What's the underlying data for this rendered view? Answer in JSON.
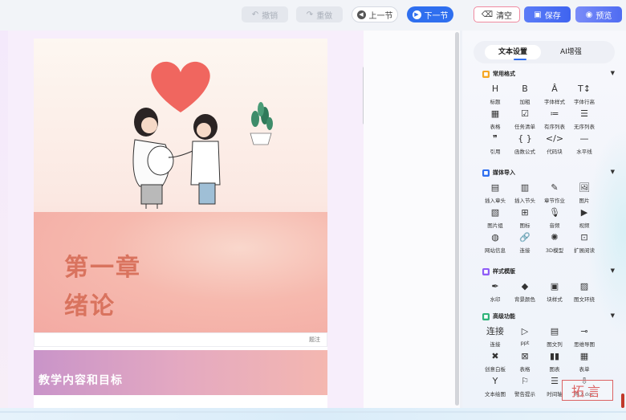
{
  "toolbar": {
    "undo": "撤销",
    "redo": "重做",
    "prev": "上一节",
    "next": "下一节",
    "clear": "清空",
    "save": "保存",
    "preview": "预览"
  },
  "editor": {
    "chapter_line1": "第一章",
    "chapter_line2": "绪论",
    "caption_label": "题注",
    "section_title": "教学内容和目标"
  },
  "panel": {
    "tabs": [
      "文本设置",
      "AI增强"
    ],
    "sections": [
      {
        "title": "常用格式",
        "color": "#f5a623",
        "tools": [
          {
            "glyph": "H",
            "label": "标题"
          },
          {
            "glyph": "B",
            "label": "加粗"
          },
          {
            "glyph": "Â",
            "label": "字体样式"
          },
          {
            "glyph": "T↕",
            "label": "字体行高"
          },
          {
            "glyph": "▦",
            "label": "表格"
          },
          {
            "glyph": "☑",
            "label": "任务清单"
          },
          {
            "glyph": "≔",
            "label": "有序列表"
          },
          {
            "glyph": "☰",
            "label": "无序列表"
          },
          {
            "glyph": "❞",
            "label": "引用"
          },
          {
            "glyph": "{ }",
            "label": "函数公式"
          },
          {
            "glyph": "</>",
            "label": "代码块"
          },
          {
            "glyph": "—",
            "label": "水平线"
          }
        ]
      },
      {
        "title": "媒体导入",
        "color": "#2f6fef",
        "tools": [
          {
            "glyph": "▤",
            "label": "插入章头"
          },
          {
            "glyph": "▥",
            "label": "插入节头"
          },
          {
            "glyph": "✎",
            "label": "章节作业"
          },
          {
            "glyph": "🖼",
            "label": "图片"
          },
          {
            "glyph": "▧",
            "label": "图片组"
          },
          {
            "glyph": "⊞",
            "label": "图标"
          },
          {
            "glyph": "🎙",
            "label": "音频"
          },
          {
            "glyph": "▶",
            "label": "视频"
          },
          {
            "glyph": "◍",
            "label": "网站信息"
          },
          {
            "glyph": "🔗",
            "label": "连接"
          },
          {
            "glyph": "✺",
            "label": "3D模型"
          },
          {
            "glyph": "⊡",
            "label": "扩展阅读"
          }
        ]
      },
      {
        "title": "样式模版",
        "color": "#8e5cf7",
        "tools": [
          {
            "glyph": "✒",
            "label": "水印"
          },
          {
            "glyph": "◆",
            "label": "背景颜色"
          },
          {
            "glyph": "▣",
            "label": "块样式"
          },
          {
            "glyph": "▨",
            "label": "图文环绕"
          }
        ]
      },
      {
        "title": "高级功能",
        "color": "#2fb37a",
        "tools": [
          {
            "glyph": "连接",
            "label": "连接"
          },
          {
            "glyph": "▷",
            "label": "ppt"
          },
          {
            "glyph": "▤",
            "label": "图文列"
          },
          {
            "glyph": "⊸",
            "label": "思维导图"
          },
          {
            "glyph": "✖",
            "label": "创意白板"
          },
          {
            "glyph": "⊠",
            "label": "表格"
          },
          {
            "glyph": "▮▮",
            "label": "图表"
          },
          {
            "glyph": "▦",
            "label": "表单"
          },
          {
            "glyph": "Y",
            "label": "文本绘图"
          },
          {
            "glyph": "⚐",
            "label": "警告提示"
          },
          {
            "glyph": "☰",
            "label": "时间轴"
          },
          {
            "glyph": "⇩",
            "label": "导入doc"
          }
        ]
      }
    ]
  },
  "watermark": "拓言"
}
